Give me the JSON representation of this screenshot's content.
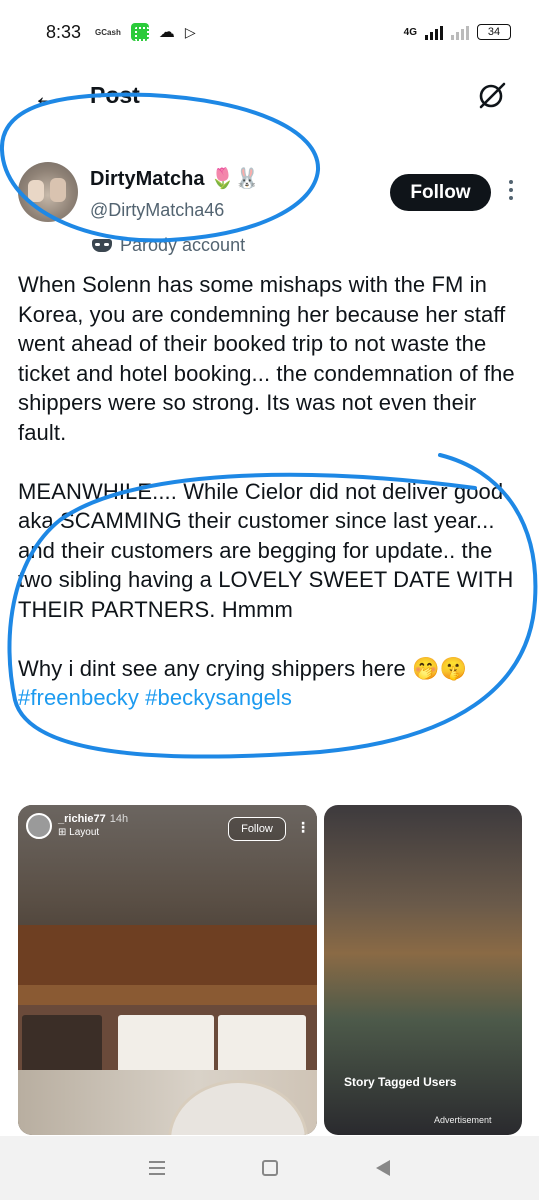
{
  "status_bar": {
    "time": "8:33",
    "gcash": "GCash",
    "network": "4G",
    "battery": "34"
  },
  "header": {
    "title": "Post",
    "back_icon": "arrow-left-icon",
    "grok_icon": "grok-icon"
  },
  "author": {
    "display_name": "DirtyMatcha 🌷🐰",
    "handle": "@DirtyMatcha46",
    "follow_label": "Follow",
    "parody_label": "Parody account"
  },
  "post": {
    "paragraph1": "When Solenn has some mishaps with the FM in Korea, you are condemning her because her staff went ahead of their booked trip to not waste the ticket and hotel booking... the condemnation of fhe shippers were so strong. Its was not even their fault.",
    "paragraph2": "MEANWHILE.... While Cielor did not deliver good aka SCAMMING their customer since last year... and their customers are begging for update.. the two sibling having a LOVELY SWEET DATE WITH THEIR PARTNERS. Hmmm",
    "paragraph3_text": "Why i dint see any crying shippers here 🤭🤫",
    "hashtag1": "#freenbecky",
    "hashtag2": "#beckysangels"
  },
  "media": {
    "story_user": "_richie77",
    "story_time": "14h",
    "story_layout": "Layout",
    "story_follow": "Follow",
    "story_tagged": "Story Tagged Users",
    "ad_label": "Advertisement"
  },
  "colors": {
    "accent": "#1d9bf0",
    "annotation": "#1e88e5",
    "text": "#0f1419",
    "muted": "#536471"
  }
}
